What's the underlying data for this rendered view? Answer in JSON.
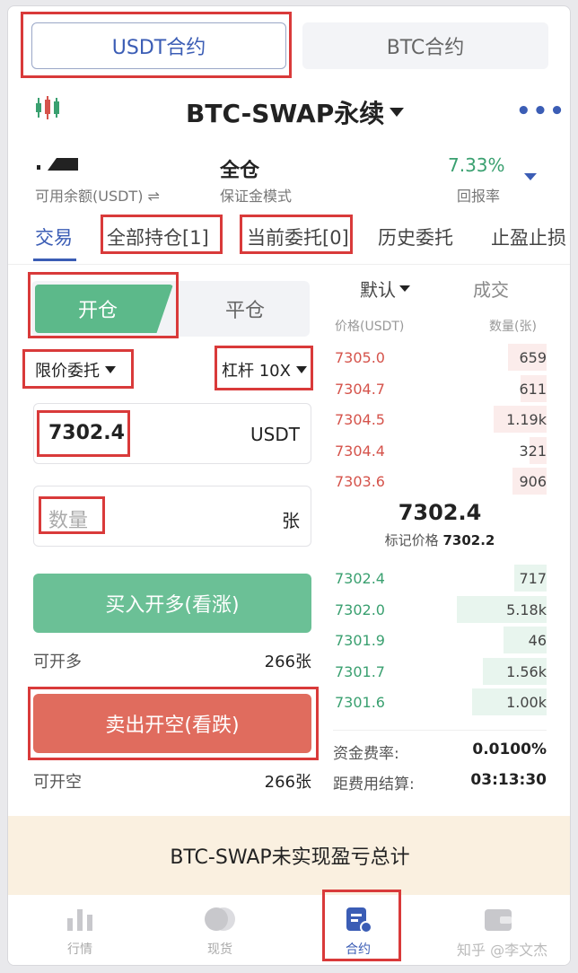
{
  "account_tabs": {
    "usdt": "USDT合约",
    "btc": "BTC合约"
  },
  "header": {
    "pair": "BTC-SWAP永续",
    "more": "•••"
  },
  "info": {
    "balance_label": "可用余额(USDT) ⇌",
    "margin_mode_value": "全仓",
    "margin_mode_label": "保证金模式",
    "return_value": "7.33%",
    "return_label": "回报率"
  },
  "section_tabs": [
    "交易",
    "全部持仓[1]",
    "当前委托[0]",
    "历史委托",
    "止盈止损"
  ],
  "trade_form": {
    "open_label": "开仓",
    "close_label": "平仓",
    "order_type": "限价委托",
    "leverage": "杠杆 10X",
    "price_value": "7302.4",
    "price_unit": "USDT",
    "qty_placeholder": "数量",
    "qty_unit": "张",
    "buy_label": "买入开多(看涨)",
    "can_open_long_label": "可开多",
    "can_open_long_value": "266张",
    "sell_label": "卖出开空(看跌)",
    "can_open_short_label": "可开空",
    "can_open_short_value": "266张"
  },
  "order_book": {
    "tab_default": "默认",
    "tab_trades": "成交",
    "col_price": "价格(USDT)",
    "col_qty": "数量(张)",
    "asks": [
      {
        "price": "7305.0",
        "qty": "659",
        "depth": 0.18
      },
      {
        "price": "7304.7",
        "qty": "611",
        "depth": 0.12
      },
      {
        "price": "7304.5",
        "qty": "1.19k",
        "depth": 0.25
      },
      {
        "price": "7304.4",
        "qty": "321",
        "depth": 0.08
      },
      {
        "price": "7303.6",
        "qty": "906",
        "depth": 0.16
      }
    ],
    "last_price": "7302.4",
    "mark_label": "标记价格",
    "mark_price": "7302.2",
    "bids": [
      {
        "price": "7302.4",
        "qty": "717",
        "depth": 0.15
      },
      {
        "price": "7302.0",
        "qty": "5.18k",
        "depth": 0.42
      },
      {
        "price": "7301.9",
        "qty": "46",
        "depth": 0.2
      },
      {
        "price": "7301.7",
        "qty": "1.56k",
        "depth": 0.3
      },
      {
        "price": "7301.6",
        "qty": "1.00k",
        "depth": 0.35
      }
    ],
    "funding_label": "资金费率:",
    "funding_value": "0.0100%",
    "settle_label": "距费用结算:",
    "settle_value": "03:13:30"
  },
  "banner": "BTC-SWAP未实现盈亏总计",
  "nav": [
    {
      "label": "行情",
      "icon": "bar-chart-icon"
    },
    {
      "label": "现货",
      "icon": "coins-icon"
    },
    {
      "label": "合约",
      "icon": "contract-icon"
    },
    {
      "label": "",
      "icon": "wallet-icon"
    }
  ],
  "watermark": "知乎 @李文杰",
  "colors": {
    "accent": "#3b5db5",
    "green": "#5cb98a",
    "red": "#e06c5e",
    "annotation": "#d93a3a"
  }
}
